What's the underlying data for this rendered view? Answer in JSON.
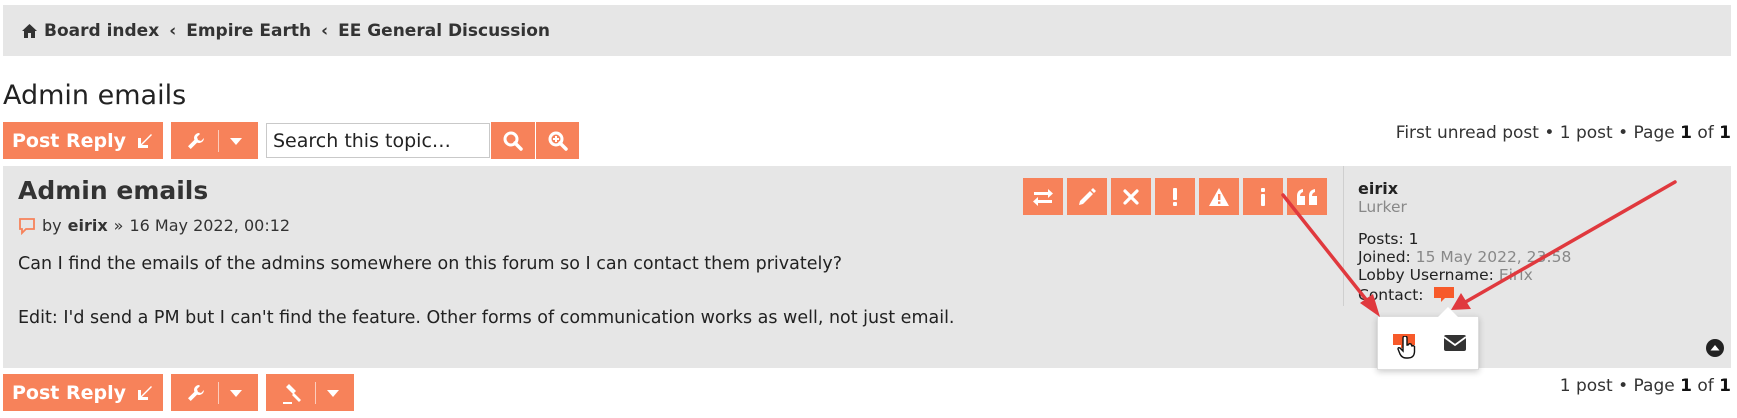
{
  "breadcrumb": {
    "items": [
      "Board index",
      "Empire Earth",
      "EE General Discussion"
    ],
    "separator": "‹"
  },
  "topic": {
    "title": "Admin emails"
  },
  "toolbar_top": {
    "post_reply_label": "Post Reply",
    "search_placeholder": "Search this topic…"
  },
  "pagination_top": {
    "first_unread": "First unread post",
    "bullet": "•",
    "post_count": "1 post",
    "page_word": "Page",
    "page_current": "1",
    "of_word": "of",
    "page_total": "1"
  },
  "post": {
    "title": "Admin emails",
    "by_word": "by",
    "author": "eirix",
    "separator": "»",
    "date": "16 May 2022, 00:12",
    "body_lines": [
      "Can I find the emails of the admins somewhere on this forum so I can contact them privately?",
      "Edit: I'd send a PM but I can't find the feature. Other forms of communication works as well, not just email."
    ]
  },
  "profile": {
    "username": "eirix",
    "rank": "Lurker",
    "posts_label": "Posts:",
    "posts_value": "1",
    "joined_label": "Joined:",
    "joined_value": "15 May 2022, 23:58",
    "lobby_label": "Lobby Username:",
    "lobby_value": "Eirix",
    "contact_label": "Contact:"
  },
  "toolbar_bottom": {
    "post_reply_label": "Post Reply"
  },
  "pagination_bottom": {
    "post_count": "1 post",
    "bullet": "•",
    "page_word": "Page",
    "page_current": "1",
    "of_word": "of",
    "page_total": "1"
  },
  "colors": {
    "accent": "#f7825a",
    "panel": "#e6e6e6",
    "annotation_arrow": "#e0393e"
  },
  "icons": [
    "home-icon",
    "reply-arrow-icon",
    "wrench-icon",
    "caret-down-icon",
    "search-icon",
    "advanced-search-icon",
    "swap-icon",
    "pencil-icon",
    "close-icon",
    "exclamation-icon",
    "warning-icon",
    "info-icon",
    "quote-icon",
    "post-icon",
    "pm-icon",
    "envelope-icon",
    "hand-pointer-icon",
    "gavel-icon",
    "back-to-top-icon"
  ]
}
